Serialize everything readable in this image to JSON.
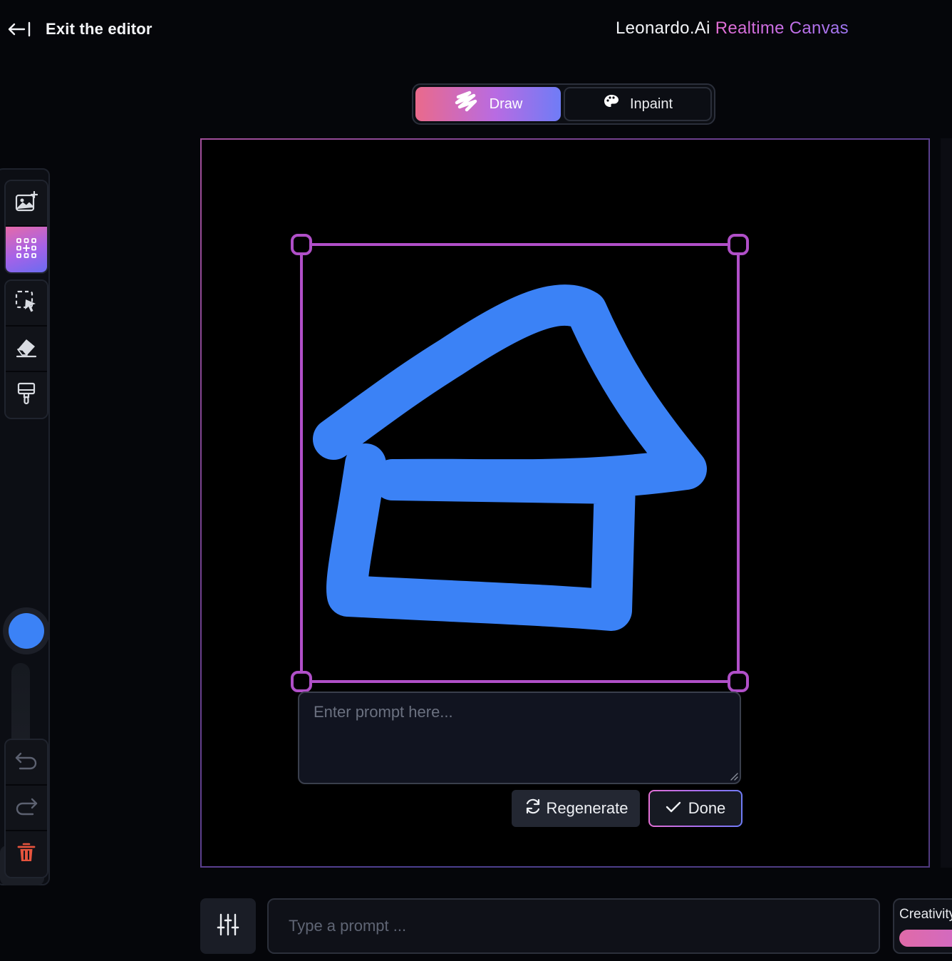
{
  "header": {
    "exit_label": "Exit the editor",
    "brand_name": "Leonardo.Ai",
    "brand_product": "Realtime Canvas"
  },
  "mode_toggle": {
    "draw_label": "Draw",
    "inpaint_label": "Inpaint",
    "active": "Draw"
  },
  "toolbar": {
    "tools": [
      "add-image-icon",
      "generate-grid-icon",
      "select-area-icon",
      "eraser-icon",
      "paint-brush-icon"
    ],
    "active_tool": "generate-grid-icon",
    "brush_color": "#3b82f6",
    "brush_size": "30",
    "brush_size_level": 0.13,
    "history": [
      "undo-icon",
      "redo-icon"
    ],
    "delete": "trash-icon",
    "delete_color": "#e5533d"
  },
  "canvas": {
    "stroke_color": "#3b82f6",
    "selection_color": "#b04fc8",
    "prompt_placeholder": "Enter prompt here...",
    "regenerate_label": "Regenerate",
    "done_label": "Done"
  },
  "bottom_bar": {
    "prompt_placeholder": "Type a prompt ...",
    "creativity_label": "Creativity"
  }
}
